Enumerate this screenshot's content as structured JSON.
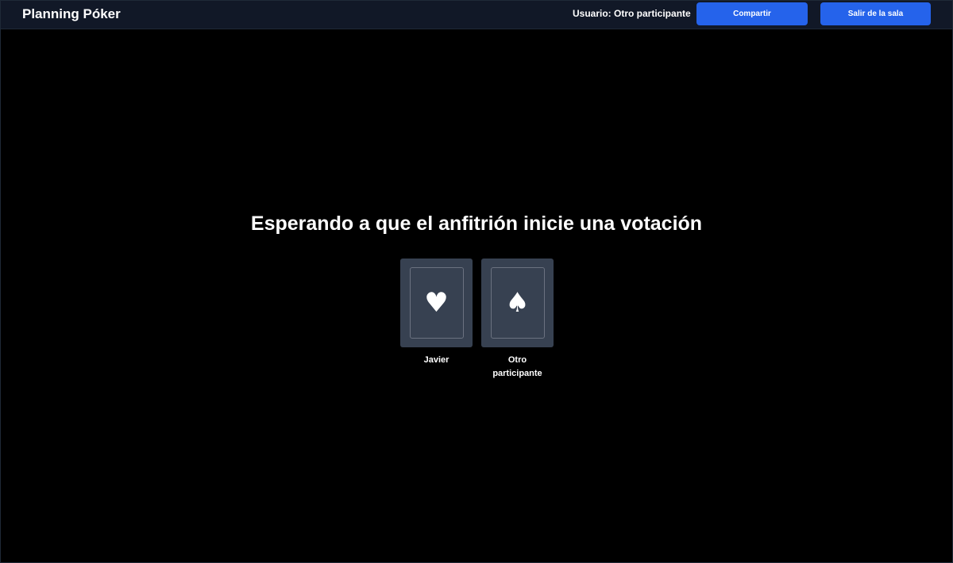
{
  "header": {
    "title": "Planning Póker",
    "user_label": "Usuario: Otro participante",
    "share_label": "Compartir",
    "leave_label": "Salir de la sala"
  },
  "main": {
    "headline": "Esperando a que el anfitrión inicie una votación",
    "players": [
      {
        "name": "Javier",
        "suit_icon": "heart-icon",
        "suit_glyph": "♥"
      },
      {
        "name": "Otro participante",
        "suit_icon": "spade-icon",
        "suit_glyph": "♠"
      }
    ]
  },
  "colors": {
    "background": "#000000",
    "topbar": "#111827",
    "accent": "#2563eb",
    "card": "#374151"
  }
}
